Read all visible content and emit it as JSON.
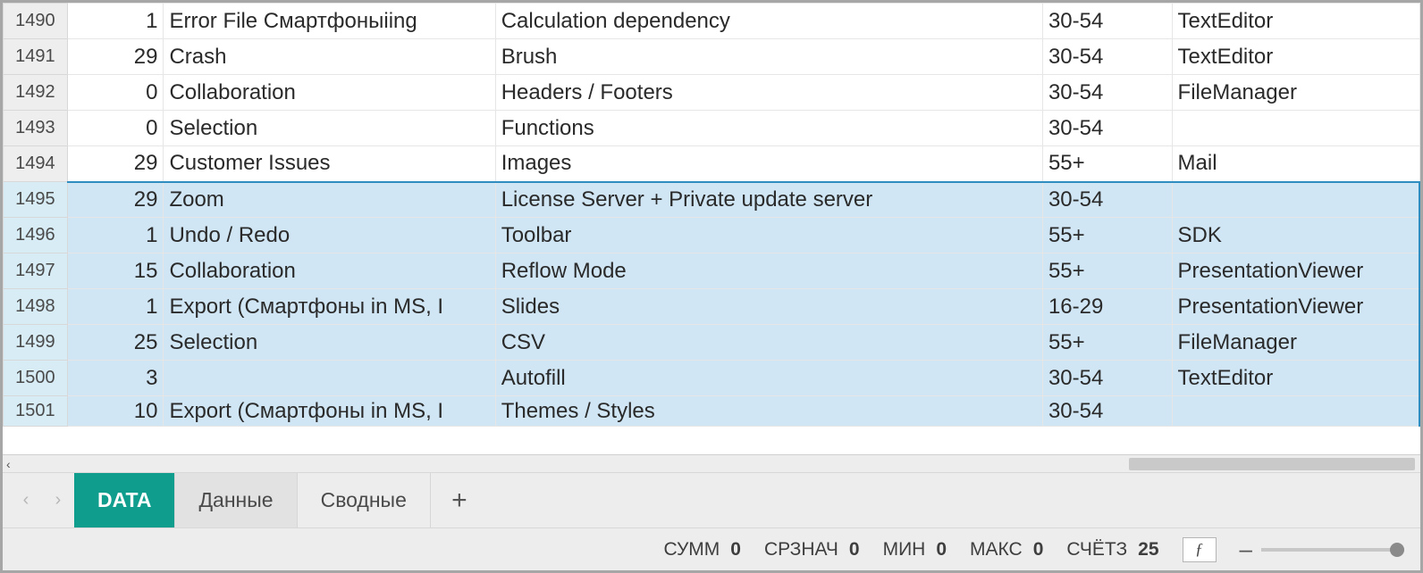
{
  "rows": [
    {
      "n": "1490",
      "a": "1",
      "b": "Error File Смартфоныiing",
      "c": "Calculation dependency",
      "d": "30-54",
      "e": "TextEditor"
    },
    {
      "n": "1491",
      "a": "29",
      "b": "Crash",
      "c": "Brush",
      "d": "30-54",
      "e": "TextEditor"
    },
    {
      "n": "1492",
      "a": "0",
      "b": "Collaboration",
      "c": "Headers / Footers",
      "d": "30-54",
      "e": "FileManager"
    },
    {
      "n": "1493",
      "a": "0",
      "b": "Selection",
      "c": "Functions",
      "d": "30-54",
      "e": ""
    },
    {
      "n": "1494",
      "a": "29",
      "b": "Customer Issues",
      "c": "Images",
      "d": "55+",
      "e": "Mail"
    },
    {
      "n": "1495",
      "a": "29",
      "b": "Zoom",
      "c": "License Server + Private update server",
      "d": "30-54",
      "e": ""
    },
    {
      "n": "1496",
      "a": "1",
      "b": "Undo / Redo",
      "c": "Toolbar",
      "d": "55+",
      "e": "SDK"
    },
    {
      "n": "1497",
      "a": "15",
      "b": "Collaboration",
      "c": "Reflow Mode",
      "d": "55+",
      "e": "PresentationViewer"
    },
    {
      "n": "1498",
      "a": "1",
      "b": "Export (Смартфоны in MS, I",
      "c": "Slides",
      "d": "16-29",
      "e": "PresentationViewer"
    },
    {
      "n": "1499",
      "a": "25",
      "b": "Selection",
      "c": "CSV",
      "d": "55+",
      "e": "FileManager"
    },
    {
      "n": "1500",
      "a": "3",
      "b": "",
      "c": "Autofill",
      "d": "30-54",
      "e": "TextEditor"
    },
    {
      "n": "1501",
      "a": "10",
      "b": "Export (Смартфоны in MS, I",
      "c": "Themes / Styles",
      "d": "30-54",
      "e": ""
    }
  ],
  "selection_start_index": 5,
  "tabs": {
    "prev_icon": "‹",
    "next_icon": "›",
    "items": [
      {
        "label": "DATA",
        "active": true
      },
      {
        "label": "Данные",
        "active": false
      },
      {
        "label": "Сводные",
        "active": false
      }
    ],
    "add_icon": "+"
  },
  "hscroll": {
    "left_icon": "‹"
  },
  "status": {
    "sum": {
      "label": "СУММ",
      "value": "0"
    },
    "avg": {
      "label": "СРЗНАЧ",
      "value": "0"
    },
    "min": {
      "label": "МИН",
      "value": "0"
    },
    "max": {
      "label": "МАКС",
      "value": "0"
    },
    "count": {
      "label": "СЧЁТЗ",
      "value": "25"
    },
    "fx_glyph": "ƒ",
    "zoom_minus": "–"
  }
}
